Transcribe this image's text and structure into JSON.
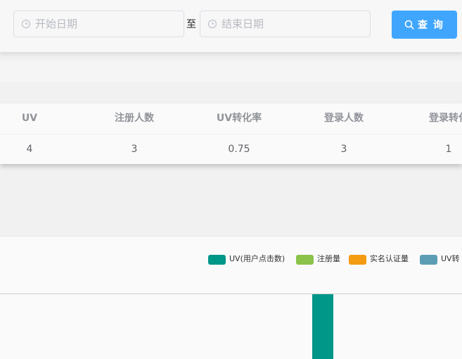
{
  "filter": {
    "start_placeholder": "开始日期",
    "end_placeholder": "结束日期",
    "separator": "至",
    "query_label": "查 询"
  },
  "stats": {
    "columns": [
      "UV",
      "注册人数",
      "UV转化率",
      "登录人数",
      "登录转化"
    ],
    "row": [
      "4",
      "3",
      "0.75",
      "3",
      "1"
    ]
  },
  "chart": {
    "legend": [
      {
        "label": "UV(用户点击数)",
        "color": "#009688"
      },
      {
        "label": "注册量",
        "color": "#8bc34a"
      },
      {
        "label": "实名认证量",
        "color": "#f39c12"
      },
      {
        "label": "UV转",
        "color": "#5b9eb4"
      }
    ]
  },
  "chart_data": {
    "type": "bar",
    "series": [
      {
        "name": "UV(用户点击数)",
        "values": [
          4
        ]
      },
      {
        "name": "注册量",
        "values": [
          3
        ]
      },
      {
        "name": "实名认证量",
        "values": []
      },
      {
        "name": "UV转",
        "values": []
      }
    ]
  }
}
